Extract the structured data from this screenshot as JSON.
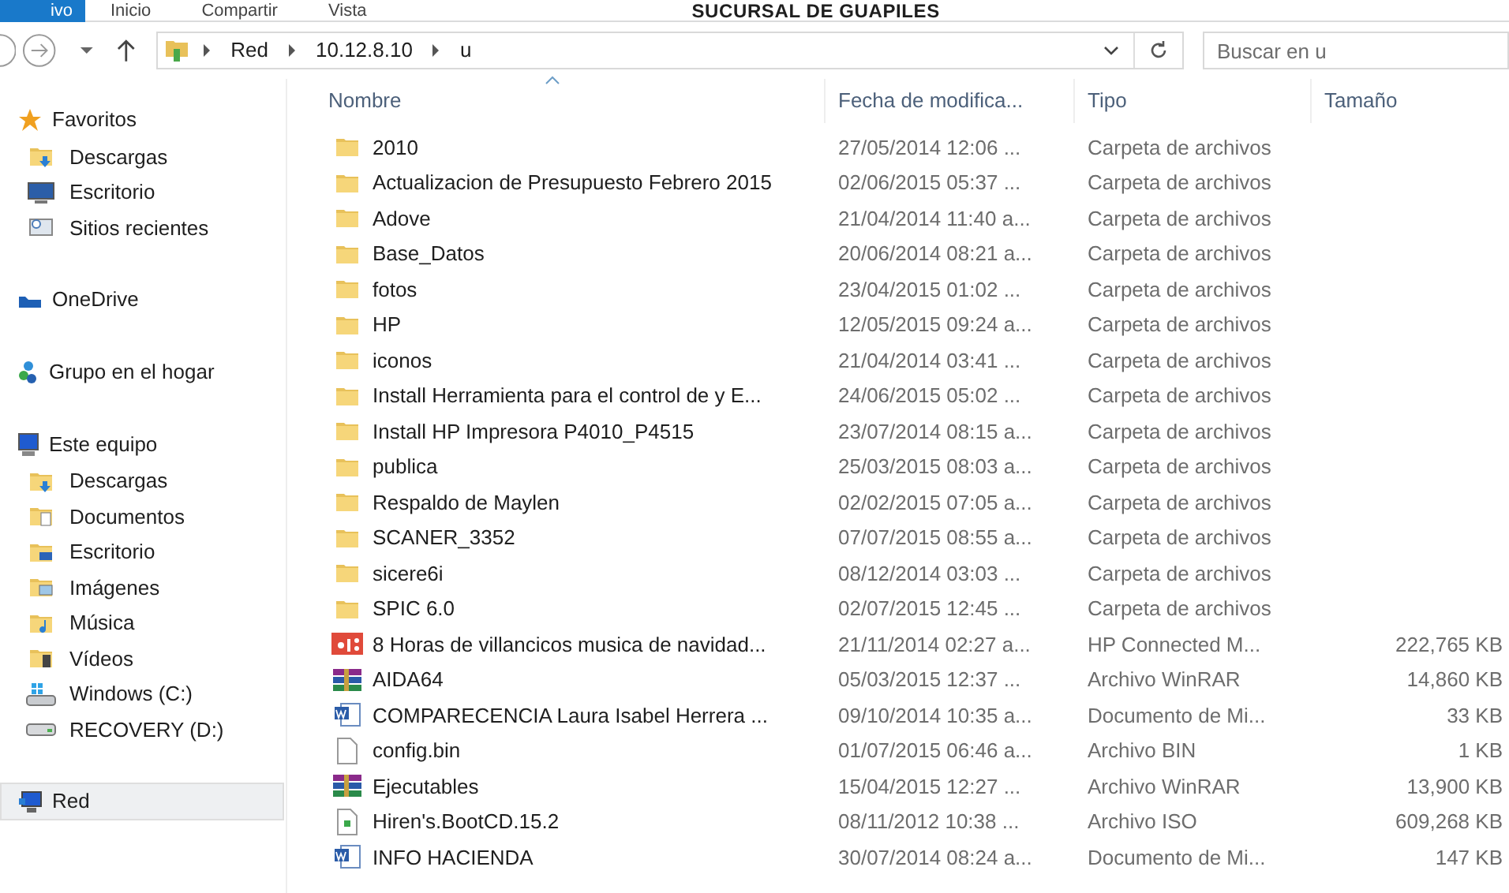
{
  "ribbon": {
    "tabs": [
      {
        "label": "ivo",
        "selected": true
      },
      {
        "label": "Inicio",
        "selected": false
      },
      {
        "label": "Compartir",
        "selected": false
      },
      {
        "label": "Vista",
        "selected": false
      }
    ],
    "title": "SUCURSAL DE GUAPILES"
  },
  "address_bar": {
    "breadcrumb": [
      "Red",
      "10.12.8.10",
      "u"
    ]
  },
  "search": {
    "placeholder": "Buscar en u"
  },
  "sidebar": {
    "groups": [
      {
        "label": "Favoritos",
        "kind": "star",
        "selected": false,
        "children": [
          {
            "label": "Descargas",
            "kind": "download",
            "selected": false
          },
          {
            "label": "Escritorio",
            "kind": "desktop",
            "selected": false
          },
          {
            "label": "Sitios recientes",
            "kind": "recent",
            "selected": false
          }
        ]
      },
      {
        "label": "OneDrive",
        "kind": "cloud",
        "selected": false
      },
      {
        "label": "Grupo en el hogar",
        "kind": "homegroup",
        "selected": false
      },
      {
        "label": "Este equipo",
        "kind": "computer",
        "selected": false,
        "children": [
          {
            "label": "Descargas",
            "kind": "download",
            "selected": false
          },
          {
            "label": "Documentos",
            "kind": "documents",
            "selected": false
          },
          {
            "label": "Escritorio",
            "kind": "desktopfolder",
            "selected": false
          },
          {
            "label": "Imágenes",
            "kind": "images",
            "selected": false
          },
          {
            "label": "Música",
            "kind": "music",
            "selected": false
          },
          {
            "label": "Vídeos",
            "kind": "videos",
            "selected": false
          },
          {
            "label": "Windows (C:)",
            "kind": "windrive",
            "selected": false
          },
          {
            "label": "RECOVERY (D:)",
            "kind": "drive",
            "selected": false
          }
        ]
      },
      {
        "label": "Red",
        "kind": "network",
        "selected": true
      }
    ]
  },
  "table": {
    "columns": [
      {
        "label": "Nombre",
        "sorted": true
      },
      {
        "label": "Fecha de modifica...",
        "sorted": false
      },
      {
        "label": "Tipo",
        "sorted": false
      },
      {
        "label": "Tamaño",
        "sorted": false
      }
    ],
    "rows": [
      {
        "kind": "folder",
        "name": "2010",
        "date": "27/05/2014 12:06 ...",
        "type": "Carpeta de archivos"
      },
      {
        "kind": "folder",
        "name": "Actualizacion de Presupuesto Febrero 2015",
        "date": "02/06/2015 05:37 ...",
        "type": "Carpeta de archivos"
      },
      {
        "kind": "folder",
        "name": "Adove",
        "date": "21/04/2014 11:40 a...",
        "type": "Carpeta de archivos"
      },
      {
        "kind": "folder",
        "name": "Base_Datos",
        "date": "20/06/2014 08:21 a...",
        "type": "Carpeta de archivos"
      },
      {
        "kind": "folder",
        "name": "fotos",
        "date": "23/04/2015 01:02 ...",
        "type": "Carpeta de archivos"
      },
      {
        "kind": "folder",
        "name": "HP",
        "date": "12/05/2015 09:24 a...",
        "type": "Carpeta de archivos"
      },
      {
        "kind": "folder",
        "name": "iconos",
        "date": "21/04/2014 03:41 ...",
        "type": "Carpeta de archivos"
      },
      {
        "kind": "folder",
        "name": "Install Herramienta para el control de y E...",
        "date": "24/06/2015 05:02 ...",
        "type": "Carpeta de archivos"
      },
      {
        "kind": "folder",
        "name": "Install HP Impresora P4010_P4515",
        "date": "23/07/2014 08:15 a...",
        "type": "Carpeta de archivos"
      },
      {
        "kind": "folder",
        "name": "publica",
        "date": "25/03/2015 08:03 a...",
        "type": "Carpeta de archivos"
      },
      {
        "kind": "folder",
        "name": "Respaldo de Maylen",
        "date": "02/02/2015 07:05 a...",
        "type": "Carpeta de archivos"
      },
      {
        "kind": "folder",
        "name": "SCANER_3352",
        "date": "07/07/2015 08:55 a...",
        "type": "Carpeta de archivos"
      },
      {
        "kind": "folder",
        "name": "sicere6i",
        "date": "08/12/2014 03:03 ...",
        "type": "Carpeta de archivos"
      },
      {
        "kind": "folder",
        "name": "SPIC 6.0",
        "date": "02/07/2015 12:45 ...",
        "type": "Carpeta de archivos"
      },
      {
        "kind": "video",
        "name": "8 Horas de villancicos musica de navidad...",
        "date": "21/11/2014 02:27 a...",
        "type": "HP Connected M...",
        "size": "222,765 KB"
      },
      {
        "kind": "archive",
        "name": "AIDA64",
        "date": "05/03/2015 12:37 ...",
        "type": "Archivo WinRAR",
        "size": "14,860 KB"
      },
      {
        "kind": "word",
        "name": "COMPARECENCIA Laura Isabel Herrera ...",
        "date": "09/10/2014 10:35 a...",
        "type": "Documento de Mi...",
        "size": "33 KB"
      },
      {
        "kind": "file",
        "name": "config.bin",
        "date": "01/07/2015 06:46 a...",
        "type": "Archivo BIN",
        "size": "1 KB"
      },
      {
        "kind": "archive",
        "name": "Ejecutables",
        "date": "15/04/2015 12:27 ...",
        "type": "Archivo WinRAR",
        "size": "13,900 KB"
      },
      {
        "kind": "disc",
        "name": "Hiren's.BootCD.15.2",
        "date": "08/11/2012 10:38 ...",
        "type": "Archivo ISO",
        "size": "609,268 KB"
      },
      {
        "kind": "word",
        "name": "INFO HACIENDA",
        "date": "30/07/2014 08:24 a...",
        "type": "Documento de Mi...",
        "size": "147 KB"
      }
    ]
  }
}
